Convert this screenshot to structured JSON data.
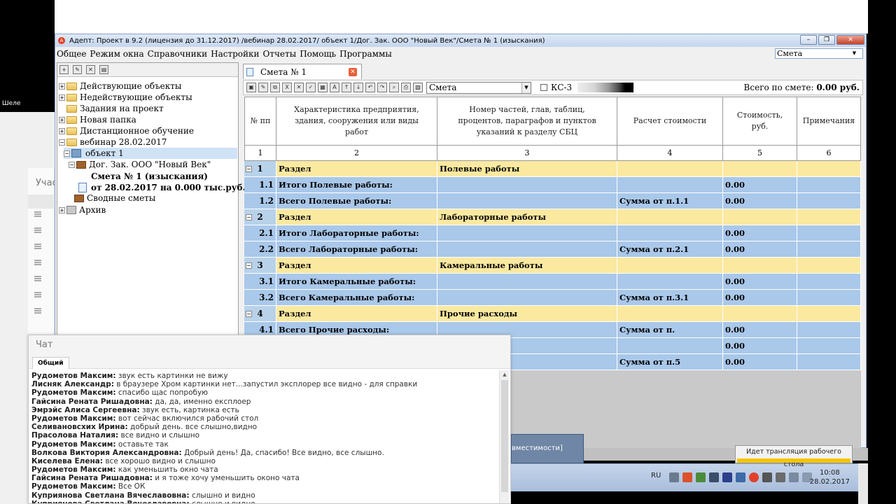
{
  "background": {
    "cut_label": "Шеле",
    "left_panel_label": "Учас"
  },
  "window": {
    "title": "Адепт: Проект в 9.2 (лицензия до 31.12.2017) /вебинар 28.02.2017/ объект 1/Дог. Зак. ООО \"Новый Век\"/Смета № 1 (изыскания)",
    "menu": [
      "Общее",
      "Режим окна",
      "Справочники",
      "Настройки",
      "Отчеты",
      "Помощь",
      "Программы"
    ],
    "combo_value": "Смета"
  },
  "tree": {
    "items": [
      {
        "label": "Действующие объекты",
        "expander": "+"
      },
      {
        "label": "Недействующие объекты",
        "expander": "+"
      },
      {
        "label": "Задания на проект",
        "expander": ""
      },
      {
        "label": "Новая папка",
        "expander": "+"
      },
      {
        "label": "Дистанционное обучение",
        "expander": "+"
      },
      {
        "label": "вебинар 28.02.2017",
        "expander": "−"
      },
      {
        "label": "объект 1",
        "expander": "−"
      },
      {
        "label": "Дог. Зак. ООО \"Новый Век\"",
        "expander": "−"
      },
      {
        "label": "Смета № 1 (изыскания)",
        "expander": ""
      },
      {
        "label": "от 28.02.2017 на 0.000 тыс.руб.",
        "expander": ""
      },
      {
        "label": "Сводные сметы",
        "expander": ""
      },
      {
        "label": "Архив",
        "expander": "+"
      }
    ]
  },
  "tab": {
    "label": "Смета № 1"
  },
  "toolbar": {
    "combo_value": "Смета",
    "ks3_label": "КС-3",
    "total_label": "Всего по смете:",
    "total_value": "0.00 руб."
  },
  "grid": {
    "headers": [
      "№ пп",
      "Характеристика предприятия, здания, сооружения или виды работ",
      "Номер частей, глав, таблиц, процентов, параграфов и пунктов указаний к разделу СБЦ",
      "Расчет стоимости",
      "Стоимость, руб.",
      "Примечания"
    ],
    "col_numbers": [
      "1",
      "2",
      "3",
      "4",
      "5",
      "6"
    ],
    "rows": [
      {
        "type": "section",
        "num": "1",
        "c2": "Раздел",
        "c3": "Полевые работы",
        "c4": "",
        "c5": ""
      },
      {
        "type": "total",
        "num": "1.1",
        "c2": "Итого Полевые работы:",
        "c3": "",
        "c4": "",
        "c5": "0.00"
      },
      {
        "type": "total",
        "num": "1.2",
        "c2": "Всего Полевые работы:",
        "c3": "",
        "c4": "Сумма от п.1.1",
        "c5": "0.00"
      },
      {
        "type": "section",
        "num": "2",
        "c2": "Раздел",
        "c3": "Лабораторные работы",
        "c4": "",
        "c5": ""
      },
      {
        "type": "total",
        "num": "2.1",
        "c2": "Итого Лабораторные работы:",
        "c3": "",
        "c4": "",
        "c5": "0.00"
      },
      {
        "type": "total",
        "num": "2.2",
        "c2": "Всего Лабораторные работы:",
        "c3": "",
        "c4": "Сумма от п.2.1",
        "c5": "0.00"
      },
      {
        "type": "section",
        "num": "3",
        "c2": "Раздел",
        "c3": "Камеральные работы",
        "c4": "",
        "c5": ""
      },
      {
        "type": "total",
        "num": "3.1",
        "c2": "Итого Камеральные работы:",
        "c3": "",
        "c4": "",
        "c5": "0.00"
      },
      {
        "type": "total",
        "num": "3.2",
        "c2": "Всего Камеральные работы:",
        "c3": "",
        "c4": "Сумма от п.3.1",
        "c5": "0.00"
      },
      {
        "type": "section",
        "num": "4",
        "c2": "Раздел",
        "c3": "Прочие расходы",
        "c4": "",
        "c5": ""
      },
      {
        "type": "total",
        "num": "4.1",
        "c2": "Всего Прочие расходы:",
        "c3": "",
        "c4": "Сумма от п.",
        "c5": "0.00"
      },
      {
        "type": "total",
        "num": "",
        "c2": "",
        "c3": "",
        "c4": "",
        "c5": "0.00"
      },
      {
        "type": "total",
        "num": "",
        "c2": "",
        "c3": "",
        "c4": "Сумма от п.5",
        "c5": "0.00"
      }
    ]
  },
  "chat": {
    "title": "Чат",
    "tab": "Общий",
    "messages": [
      {
        "author": "Рудометов Максим:",
        "text": "звук есть картинки не вижу"
      },
      {
        "author": "Лисняк Александр:",
        "text": "в браузере Хром картинки нет...запустил эксплорер все видно - для справки"
      },
      {
        "author": "Рудометов Максим:",
        "text": "спасибо щас попробую"
      },
      {
        "author": "Гайсина Рената Ришадовна:",
        "text": "да, да, именно експлоер"
      },
      {
        "author": "Эмрэйс Алиса Сергеевна:",
        "text": "звук есть, картинка есть"
      },
      {
        "author": "Рудометов Максим:",
        "text": "вот сейчас включился рабочий стол"
      },
      {
        "author": "Селивановсхих Ирина:",
        "text": "добрый день. все слышно,видно"
      },
      {
        "author": "Прасолова Наталия:",
        "text": "все видно и слышно"
      },
      {
        "author": "Рудометов Максим:",
        "text": "оставьте так"
      },
      {
        "author": "Волкова Виктория Александровна:",
        "text": "Добрый день! Да, спасибо! Все видно, все слышно."
      },
      {
        "author": "Киселева Елена:",
        "text": "все хорошо видно и слышно"
      },
      {
        "author": "Рудометов Максим:",
        "text": "как уменьшить окно чата"
      },
      {
        "author": "Гайсина Рената Ришадовна:",
        "text": "и я тоже хочу уменьшить оконо чата"
      },
      {
        "author": "Рудометов Максим:",
        "text": "Все ОК"
      },
      {
        "author": "Куприянова Светлана  Вячеславовна:",
        "text": "слышно и видно"
      },
      {
        "author": "Куприянова Светлана  Вячеславовна:",
        "text": "слышно и видно"
      }
    ]
  },
  "taskbar": {
    "chip_label": "вместимости]",
    "lang": "RU",
    "time": "10:08",
    "date": "28.02.2017",
    "broadcast": "Идет трансляция рабочего стола"
  }
}
